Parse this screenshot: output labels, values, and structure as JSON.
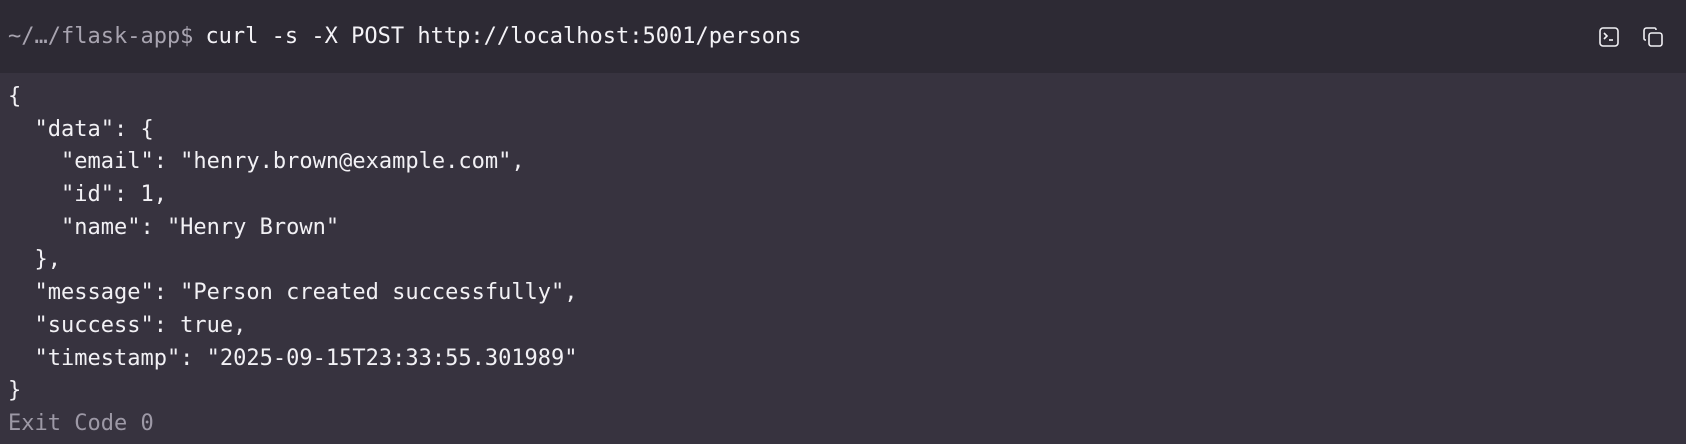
{
  "header": {
    "prompt": "~/…/flask-app$",
    "command": "curl -s -X POST http://localhost:5001/persons",
    "icons": [
      "terminal-icon",
      "copy-icon"
    ]
  },
  "output": {
    "lines": [
      "{",
      "  \"data\": {",
      "    \"email\": \"henry.brown@example.com\",",
      "    \"id\": 1,",
      "    \"name\": \"Henry Brown\"",
      "  },",
      "  \"message\": \"Person created successfully\",",
      "  \"success\": true,",
      "  \"timestamp\": \"2025-09-15T23:33:55.301989\"",
      "}"
    ],
    "exit_code": "Exit Code 0"
  },
  "colors": {
    "background": "#37333f",
    "header_background": "#2d2a34",
    "text": "#f2f1f5",
    "muted": "#a8a4b0"
  }
}
